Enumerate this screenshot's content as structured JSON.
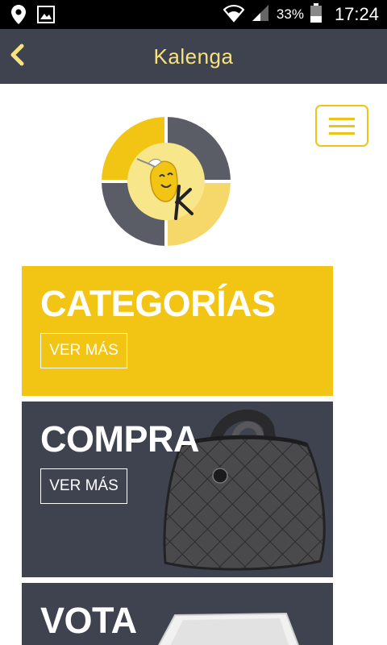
{
  "status_bar": {
    "battery_percent": "33%",
    "time": "17:24",
    "icons": [
      "location-icon",
      "image-icon",
      "wifi-icon",
      "signal-icon",
      "battery-icon"
    ]
  },
  "app_bar": {
    "title": "Kalenga",
    "back_icon": "chevron-left-icon"
  },
  "logo": {
    "letter": "K",
    "colors": [
      "#f2c413",
      "#5a5d66",
      "#f6d76a",
      "#f8e68a"
    ]
  },
  "menu": {
    "icon": "hamburger-icon"
  },
  "tiles": [
    {
      "title": "CATEGORÍAS",
      "button": "VER MÁS"
    },
    {
      "title": "COMPRA",
      "button": "VER MÁS"
    },
    {
      "title": "VOTA"
    }
  ],
  "colors": {
    "yellow": "#f2c413",
    "dark": "#3f4350",
    "title_yellow": "#f6e27f"
  }
}
